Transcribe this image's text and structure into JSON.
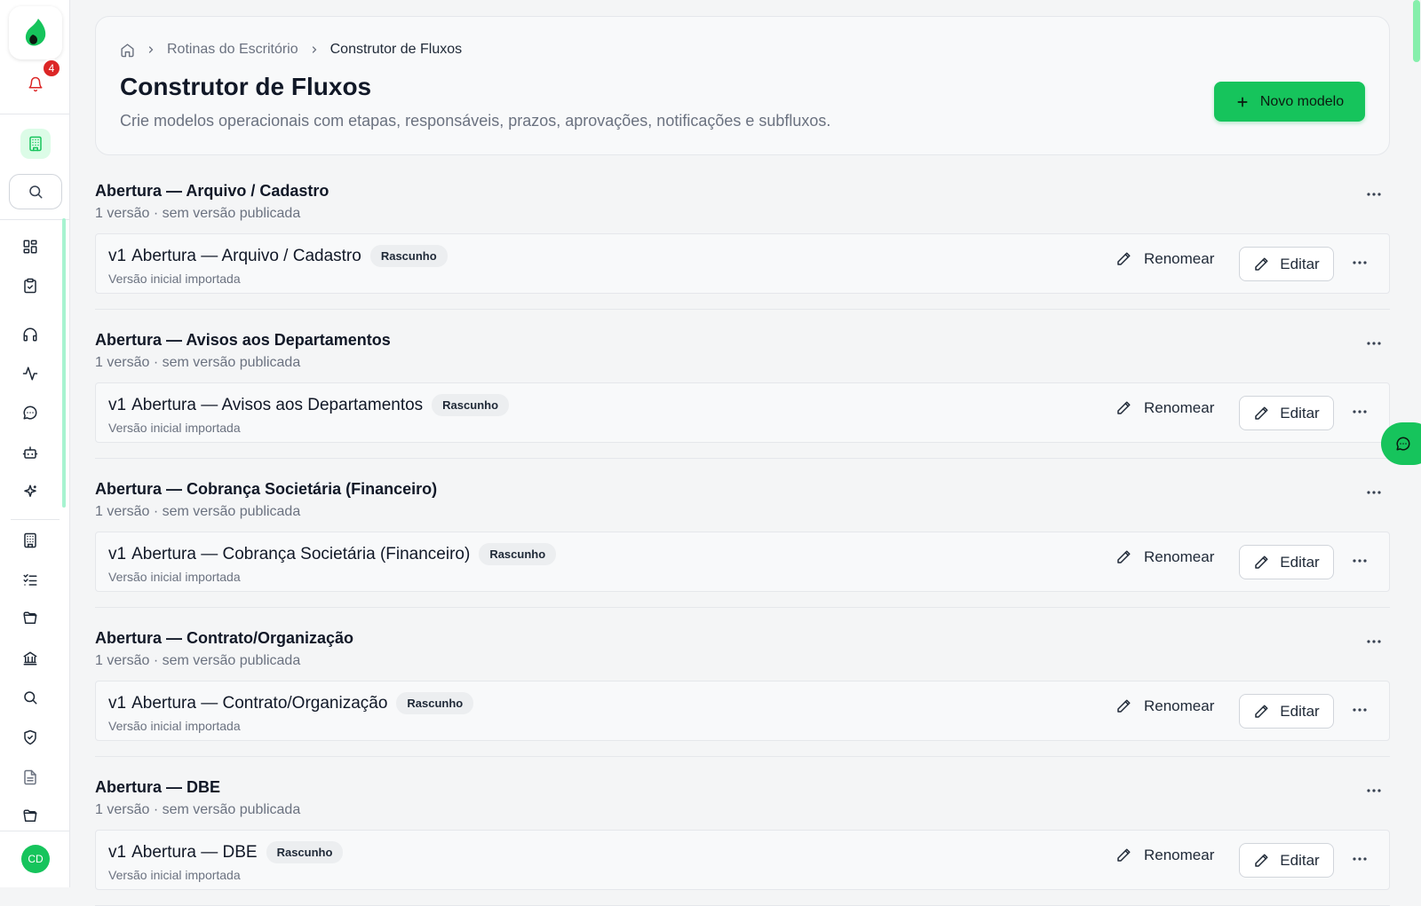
{
  "sidebar": {
    "notification_count": "4",
    "avatar_initials": "CD",
    "icons": [
      "logo-icon",
      "bell-icon",
      "building-icon",
      "search-icon",
      "dashboard-icon",
      "clipboard-check-icon",
      "headphones-icon",
      "activity-icon",
      "chat-icon",
      "bot-icon",
      "sparkles-icon",
      "building-icon",
      "list-check-icon",
      "folder-open-icon",
      "bank-icon",
      "search-icon",
      "shield-check-icon",
      "document-icon",
      "folder-open-icon"
    ]
  },
  "header": {
    "breadcrumb": [
      "Rotinas do Escritório",
      "Construtor de Fluxos"
    ],
    "title": "Construtor de Fluxos",
    "subtitle": "Crie modelos operacionais com etapas, responsáveis, prazos, aprovações, notificações e subfluxos.",
    "new_button": "Novo modelo"
  },
  "groups": [
    {
      "title": "Abertura — Arquivo / Cadastro",
      "meta": "1 versão · sem versão publicada",
      "version": "v1",
      "version_name": "Abertura — Arquivo / Cadastro",
      "badge": "Rascunho",
      "note": "Versão inicial importada"
    },
    {
      "title": "Abertura — Avisos aos Departamentos",
      "meta": "1 versão · sem versão publicada",
      "version": "v1",
      "version_name": "Abertura — Avisos aos Departamentos",
      "badge": "Rascunho",
      "note": "Versão inicial importada"
    },
    {
      "title": "Abertura — Cobrança Societária (Financeiro)",
      "meta": "1 versão · sem versão publicada",
      "version": "v1",
      "version_name": "Abertura — Cobrança Societária (Financeiro)",
      "badge": "Rascunho",
      "note": "Versão inicial importada"
    },
    {
      "title": "Abertura — Contrato/Organização",
      "meta": "1 versão · sem versão publicada",
      "version": "v1",
      "version_name": "Abertura — Contrato/Organização",
      "badge": "Rascunho",
      "note": "Versão inicial importada"
    },
    {
      "title": "Abertura — DBE",
      "meta": "1 versão · sem versão publicada",
      "version": "v1",
      "version_name": "Abertura — DBE",
      "badge": "Rascunho",
      "note": "Versão inicial importada"
    }
  ],
  "actions": {
    "rename_label": "Renomear",
    "edit_label": "Editar",
    "more_label": "···"
  },
  "colors": {
    "accent": "#16c45c",
    "badge_bg": "#eceef0",
    "notification": "#dc2626"
  }
}
